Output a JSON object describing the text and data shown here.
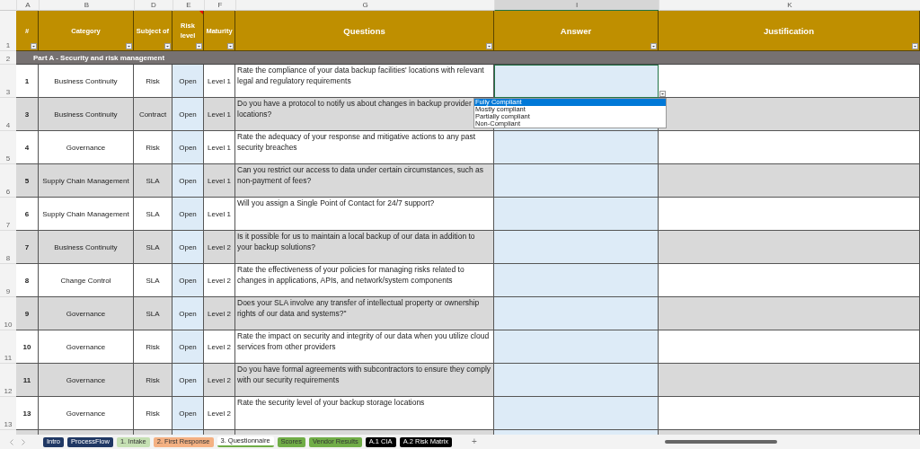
{
  "column_letters": [
    {
      "label": "A",
      "selected": false
    },
    {
      "label": "B",
      "selected": false
    },
    {
      "label": "D",
      "selected": false
    },
    {
      "label": "E",
      "selected": false
    },
    {
      "label": "F",
      "selected": false
    },
    {
      "label": "G",
      "selected": false
    },
    {
      "label": "I",
      "selected": true
    },
    {
      "label": "K",
      "selected": false
    }
  ],
  "header": {
    "row_number": "1",
    "columns": [
      "#",
      "Category",
      "Subject of",
      "Risk level",
      "Maturity",
      "Questions",
      "Answer",
      "Justification"
    ]
  },
  "section": {
    "row_number": "2",
    "title": "Part A - Security and risk management"
  },
  "rows": [
    {
      "row_number": "3",
      "id": "1",
      "category": "Business Continuity",
      "subject": "Risk",
      "risk_level": "Open",
      "maturity": "Level 1",
      "question": "Rate the compliance of your data backup facilities' locations with relevant legal and regulatory requirements",
      "selected": true
    },
    {
      "row_number": "4",
      "id": "3",
      "category": "Business Continuity",
      "subject": "Contract",
      "risk_level": "Open",
      "maturity": "Level 1",
      "question": "Do you have a protocol to notify us about changes in backup provider locations?",
      "selected": false
    },
    {
      "row_number": "5",
      "id": "4",
      "category": "Governance",
      "subject": "Risk",
      "risk_level": "Open",
      "maturity": "Level 1",
      "question": "Rate the adequacy of your response and mitigative actions to any past security breaches",
      "selected": false
    },
    {
      "row_number": "6",
      "id": "5",
      "category": "Supply Chain Management",
      "subject": "SLA",
      "risk_level": "Open",
      "maturity": "Level 1",
      "question": "Can you restrict our access to data under certain circumstances, such as non-payment of fees?",
      "selected": false
    },
    {
      "row_number": "7",
      "id": "6",
      "category": "Supply Chain Management",
      "subject": "SLA",
      "risk_level": "Open",
      "maturity": "Level 1",
      "question": "Will you assign a Single Point of Contact for 24/7 support?",
      "selected": false
    },
    {
      "row_number": "8",
      "id": "7",
      "category": "Business Continuity",
      "subject": "SLA",
      "risk_level": "Open",
      "maturity": "Level 2",
      "question": "Is it possible for us to maintain a local backup of our data in addition to your backup solutions?",
      "selected": false
    },
    {
      "row_number": "9",
      "id": "8",
      "category": "Change Control",
      "subject": "SLA",
      "risk_level": "Open",
      "maturity": "Level 2",
      "question": "Rate the effectiveness of your policies for managing risks related to changes in applications, APIs, and network/system components",
      "selected": false
    },
    {
      "row_number": "10",
      "id": "9",
      "category": "Governance",
      "subject": "SLA",
      "risk_level": "Open",
      "maturity": "Level 2",
      "question": "Does your SLA involve any transfer of intellectual property or ownership rights of our data and systems?\"",
      "selected": false
    },
    {
      "row_number": "11",
      "id": "10",
      "category": "Governance",
      "subject": "Risk",
      "risk_level": "Open",
      "maturity": "Level 2",
      "question": "Rate the impact on security and integrity of our data when you utilize cloud services from other providers",
      "selected": false
    },
    {
      "row_number": "12",
      "id": "11",
      "category": "Governance",
      "subject": "Risk",
      "risk_level": "Open",
      "maturity": "Level 2",
      "question": "Do you have formal agreements with subcontractors to ensure they comply with our security requirements",
      "selected": false
    },
    {
      "row_number": "13",
      "id": "13",
      "category": "Governance",
      "subject": "Risk",
      "risk_level": "Open",
      "maturity": "Level 2",
      "question": "Rate the security level of your backup storage locations",
      "selected": false
    }
  ],
  "dropdown": {
    "options": [
      {
        "label": "Fully Compliant",
        "selected": true
      },
      {
        "label": "Mostly compliant",
        "selected": false
      },
      {
        "label": "Partially compliant",
        "selected": false
      },
      {
        "label": "Non-Compliant",
        "selected": false
      }
    ]
  },
  "sheet_tabs": [
    {
      "label": "Intro",
      "color": "#203864",
      "selected": false
    },
    {
      "label": "ProcessFlow",
      "color": "#203864",
      "selected": false
    },
    {
      "label": "1. Intake",
      "color": "#c5e0b3",
      "selected": false
    },
    {
      "label": "2. First Response",
      "color": "#f4b183",
      "selected": false
    },
    {
      "label": "3. Questionnaire",
      "color": "#70ad47",
      "selected": true
    },
    {
      "label": "Scores",
      "color": "#70ad47",
      "selected": false
    },
    {
      "label": "Vendor Results",
      "color": "#70ad47",
      "selected": false
    },
    {
      "label": "A.1 CIA",
      "color": "#000000",
      "selected": false
    },
    {
      "label": "A.2 Risk Matrix",
      "color": "#000000",
      "selected": false
    }
  ],
  "add_sheet": "+"
}
